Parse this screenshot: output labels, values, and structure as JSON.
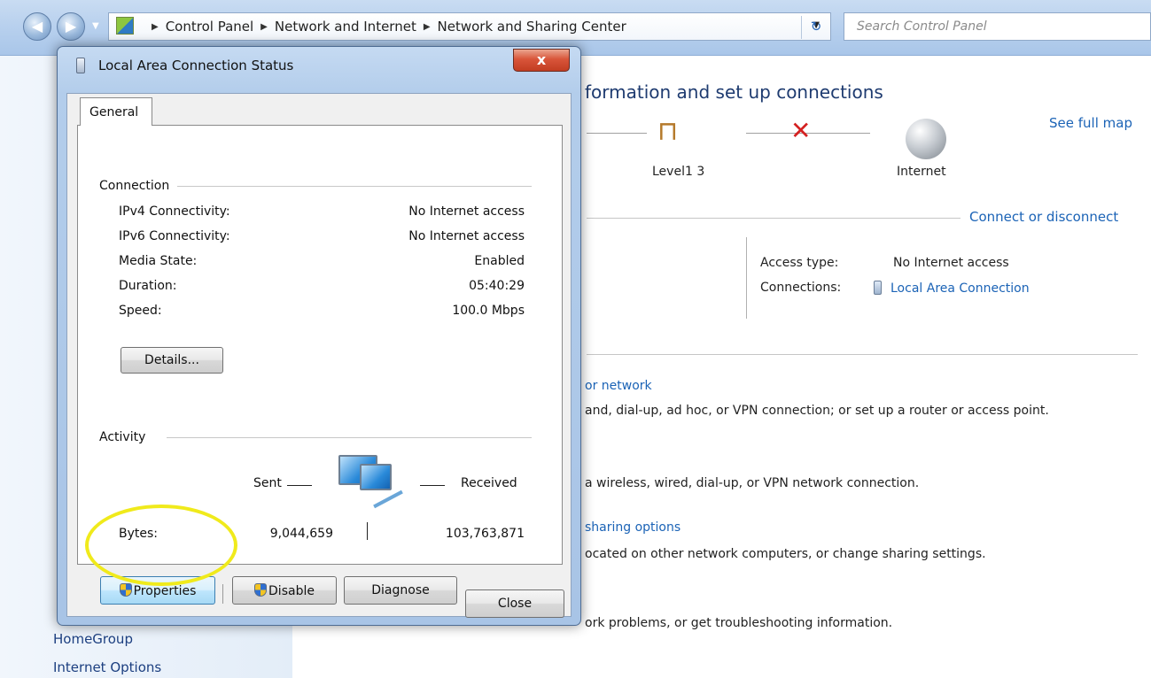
{
  "addressbar": {
    "crumbs": [
      "Control Panel",
      "Network and Internet",
      "Network and Sharing Center"
    ],
    "search_placeholder": "Search Control Panel"
  },
  "leftpane": {
    "items": [
      "HomeGroup",
      "Internet Options"
    ]
  },
  "main": {
    "title": "formation and set up connections",
    "see_full_map": "See full map",
    "node_computer": "Level1 3",
    "node_internet": "Internet",
    "connect_or_disconnect": "Connect or disconnect",
    "access_type_label": "Access type:",
    "access_type_value": "No Internet access",
    "connections_label": "Connections:",
    "connections_value": "Local Area Connection",
    "tasks": [
      {
        "link": "or network",
        "desc": "and, dial-up, ad hoc, or VPN connection; or set up a router or access point."
      },
      {
        "link": "",
        "desc": "a wireless, wired, dial-up, or VPN network connection."
      },
      {
        "link": "sharing options",
        "desc": "ocated on other network computers, or change sharing settings."
      },
      {
        "link": "",
        "desc": "ork problems, or get troubleshooting information."
      }
    ]
  },
  "dialog": {
    "title": "Local Area Connection Status",
    "close_glyph": "x",
    "tab_general": "General",
    "connection_group": "Connection",
    "rows": [
      {
        "label": "IPv4 Connectivity:",
        "value": "No Internet access"
      },
      {
        "label": "IPv6 Connectivity:",
        "value": "No Internet access"
      },
      {
        "label": "Media State:",
        "value": "Enabled"
      },
      {
        "label": "Duration:",
        "value": "05:40:29"
      },
      {
        "label": "Speed:",
        "value": "100.0 Mbps"
      }
    ],
    "details_button": "Details...",
    "activity_group": "Activity",
    "sent_label": "Sent",
    "received_label": "Received",
    "bytes_label": "Bytes:",
    "bytes_sent": "9,044,659",
    "bytes_received": "103,763,871",
    "properties_button": "Properties",
    "disable_button": "Disable",
    "diagnose_button": "Diagnose",
    "close_button": "Close"
  },
  "colors": {
    "link": "#1b63b6",
    "highlight_ring": "#f0ea1b",
    "close_button_red": "#d9553a"
  }
}
